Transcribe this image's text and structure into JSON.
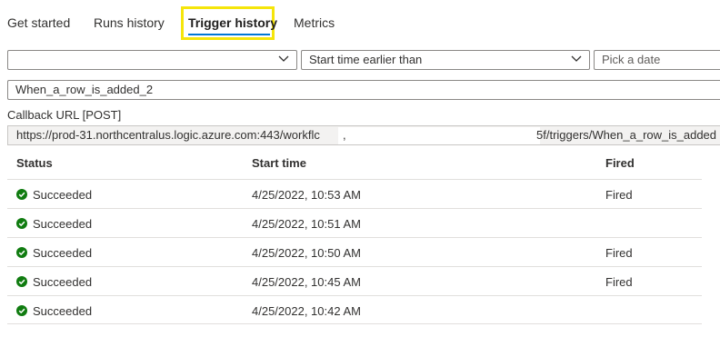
{
  "tabs": [
    {
      "label": "Get started"
    },
    {
      "label": "Runs history"
    },
    {
      "label": "Trigger history"
    },
    {
      "label": "Metrics"
    }
  ],
  "filters": {
    "status_value": "",
    "time_filter": "Start time earlier than",
    "date_placeholder": "Pick a date"
  },
  "trigger_name": "When_a_row_is_added_2",
  "callback": {
    "label": "Callback URL [POST]",
    "url_start": "https://prod-31.northcentralus.logic.azure.com:443/workflc",
    "url_mid": ",",
    "url_end": "5f/triggers/When_a_row_is_added"
  },
  "table": {
    "headers": {
      "status": "Status",
      "start_time": "Start time",
      "fired": "Fired"
    },
    "rows": [
      {
        "status": "Succeeded",
        "start_time": "4/25/2022, 10:53 AM",
        "fired": "Fired"
      },
      {
        "status": "Succeeded",
        "start_time": "4/25/2022, 10:51 AM",
        "fired": ""
      },
      {
        "status": "Succeeded",
        "start_time": "4/25/2022, 10:50 AM",
        "fired": "Fired"
      },
      {
        "status": "Succeeded",
        "start_time": "4/25/2022, 10:45 AM",
        "fired": "Fired"
      },
      {
        "status": "Succeeded",
        "start_time": "4/25/2022, 10:42 AM",
        "fired": ""
      }
    ]
  },
  "colors": {
    "accent": "#0078d4",
    "success": "#107c10",
    "highlight": "#f5e50a"
  },
  "icons": {
    "dropdown": "chevron-down-icon",
    "status": "success-check-icon"
  }
}
